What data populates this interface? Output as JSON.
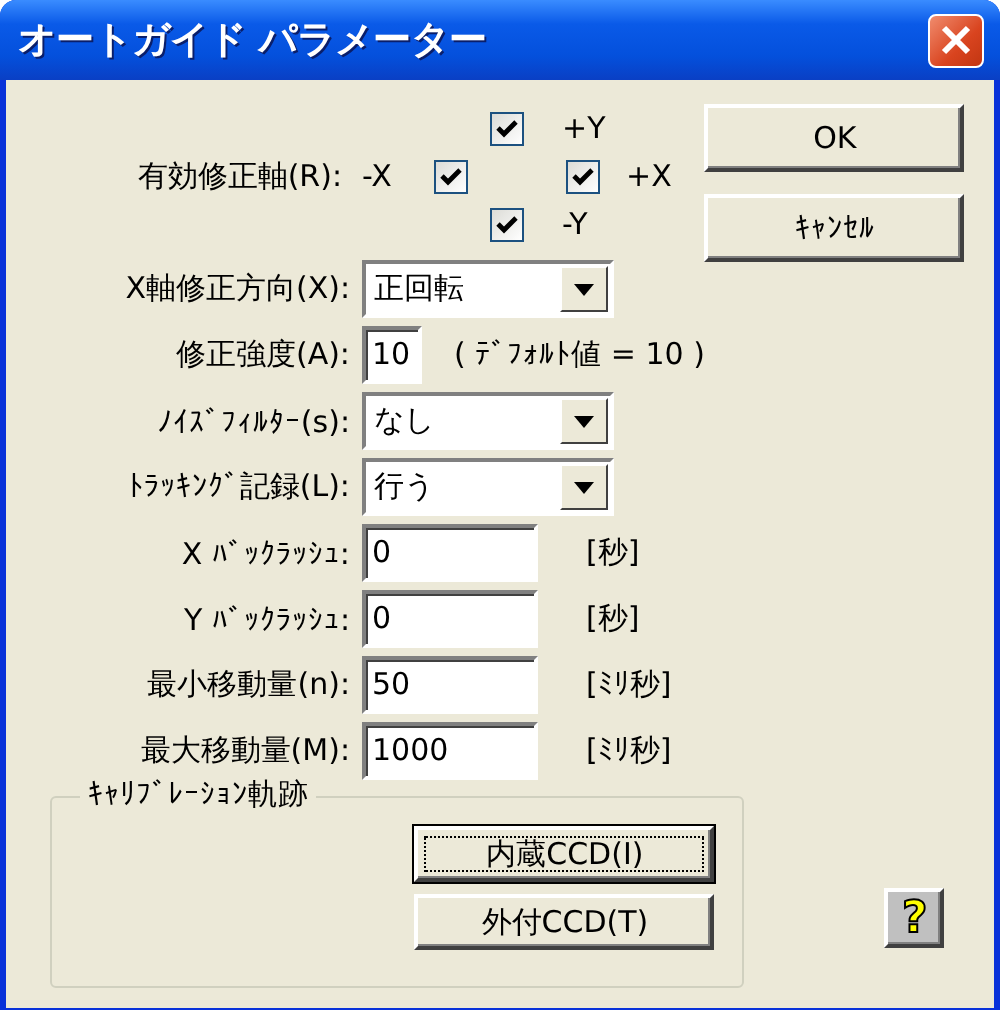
{
  "window": {
    "title": "オートガイド パラメーター"
  },
  "axes": {
    "label": "有効修正軸(R):",
    "x_minus_label": "-X",
    "boxes": [
      {
        "label": "+Y",
        "checked": true
      },
      {
        "checked": true
      },
      {
        "label": "+X",
        "checked": true
      },
      {
        "label": "-Y",
        "checked": true
      }
    ]
  },
  "fields": [
    {
      "kind": "dropdown",
      "label": "X軸修正方向(X):",
      "value": "正回転"
    },
    {
      "kind": "narrow_text",
      "label": "修正強度(A):",
      "value": "10",
      "note": "( ﾃﾞﾌｫﾙﾄ値 = 10 )"
    },
    {
      "kind": "dropdown",
      "label": "ﾉｲｽﾞﾌｨﾙﾀｰ(s):",
      "value": "なし"
    },
    {
      "kind": "dropdown",
      "label": "ﾄﾗｯｷﾝｸﾞ記録(L):",
      "value": "行う"
    },
    {
      "kind": "text",
      "label": "X ﾊﾞｯｸﾗｯｼｭ:",
      "value": "0",
      "note": "[秒]"
    },
    {
      "kind": "text",
      "label": "Y ﾊﾞｯｸﾗｯｼｭ:",
      "value": "0",
      "note": "[秒]"
    },
    {
      "kind": "text",
      "label": "最小移動量(n):",
      "value": "50",
      "note": "[ﾐﾘ秒]"
    },
    {
      "kind": "text",
      "label": "最大移動量(M):",
      "value": "1000",
      "note": "[ﾐﾘ秒]"
    }
  ],
  "calibration": {
    "title": "ｷｬﾘﾌﾞﾚｰｼｮﾝ軌跡",
    "buttons": [
      {
        "label": "内蔵CCD(I)",
        "focused": true
      },
      {
        "label": "外付CCD(T)",
        "focused": false
      }
    ]
  },
  "buttons": [
    "OK",
    "ｷｬﾝｾﾙ"
  ],
  "help": {
    "label": "?"
  }
}
